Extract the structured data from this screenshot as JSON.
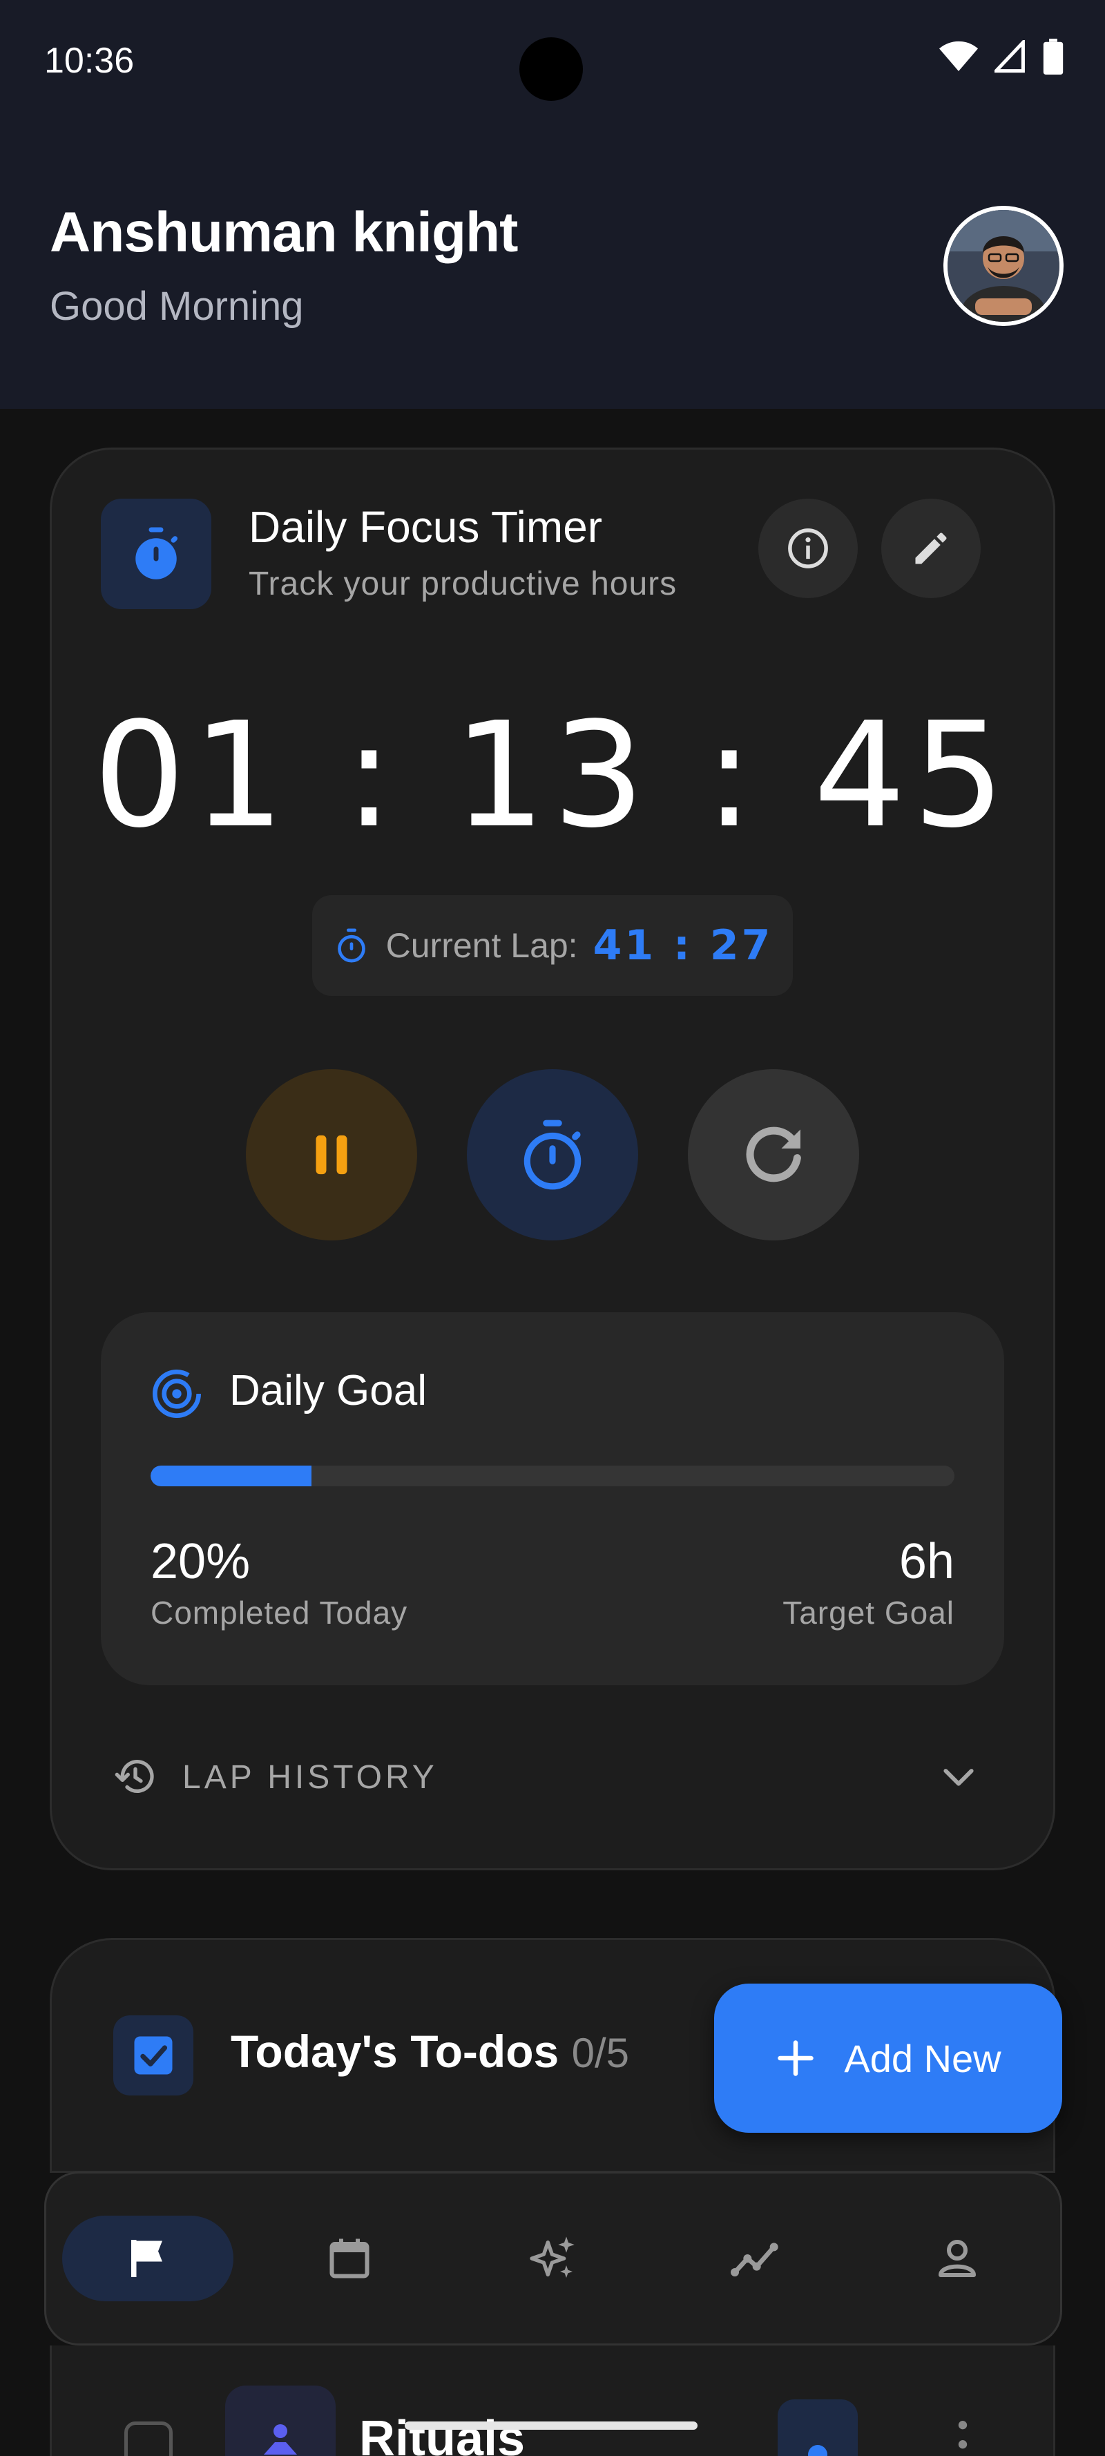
{
  "status_bar": {
    "time": "10:36",
    "icons": [
      "wifi-icon",
      "signal-icon",
      "battery-icon"
    ]
  },
  "header": {
    "name": "Anshuman knight",
    "greeting": "Good Morning"
  },
  "timer": {
    "title": "Daily Focus Timer",
    "subtitle": "Track your productive hours",
    "clock": "01 : 13 : 45",
    "lap_label": "Current Lap:",
    "lap_value": "41 : 27"
  },
  "goal": {
    "title": "Daily Goal",
    "progress": 0.2,
    "percent_text": "20%",
    "percent_label": "Completed Today",
    "target_text": "6h",
    "target_label": "Target Goal"
  },
  "lap_history": {
    "label": "LAP HISTORY"
  },
  "todos": {
    "title": "Today's To-dos",
    "count": "0/5"
  },
  "add_button": {
    "label": "Add New"
  },
  "nav": {
    "items": [
      "flag-icon",
      "calendar-icon",
      "sparkle-icon",
      "insights-icon",
      "person-icon"
    ],
    "active": 0
  },
  "rituals": {
    "title": "Rituals"
  },
  "colors": {
    "accent": "#2e7cf6",
    "pause": "#f5a011",
    "background": "#121212",
    "card": "#1d1d1d"
  }
}
